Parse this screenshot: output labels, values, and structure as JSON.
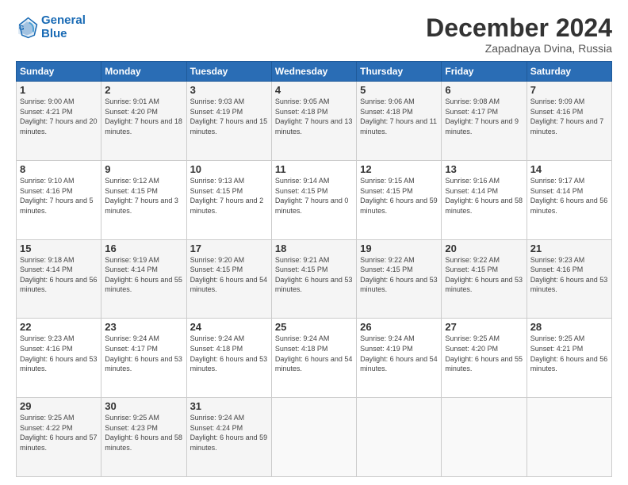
{
  "header": {
    "logo_line1": "General",
    "logo_line2": "Blue",
    "month": "December 2024",
    "location": "Zapadnaya Dvina, Russia"
  },
  "weekdays": [
    "Sunday",
    "Monday",
    "Tuesday",
    "Wednesday",
    "Thursday",
    "Friday",
    "Saturday"
  ],
  "weeks": [
    [
      {
        "day": "1",
        "sunrise": "Sunrise: 9:00 AM",
        "sunset": "Sunset: 4:21 PM",
        "daylight": "Daylight: 7 hours and 20 minutes."
      },
      {
        "day": "2",
        "sunrise": "Sunrise: 9:01 AM",
        "sunset": "Sunset: 4:20 PM",
        "daylight": "Daylight: 7 hours and 18 minutes."
      },
      {
        "day": "3",
        "sunrise": "Sunrise: 9:03 AM",
        "sunset": "Sunset: 4:19 PM",
        "daylight": "Daylight: 7 hours and 15 minutes."
      },
      {
        "day": "4",
        "sunrise": "Sunrise: 9:05 AM",
        "sunset": "Sunset: 4:18 PM",
        "daylight": "Daylight: 7 hours and 13 minutes."
      },
      {
        "day": "5",
        "sunrise": "Sunrise: 9:06 AM",
        "sunset": "Sunset: 4:18 PM",
        "daylight": "Daylight: 7 hours and 11 minutes."
      },
      {
        "day": "6",
        "sunrise": "Sunrise: 9:08 AM",
        "sunset": "Sunset: 4:17 PM",
        "daylight": "Daylight: 7 hours and 9 minutes."
      },
      {
        "day": "7",
        "sunrise": "Sunrise: 9:09 AM",
        "sunset": "Sunset: 4:16 PM",
        "daylight": "Daylight: 7 hours and 7 minutes."
      }
    ],
    [
      {
        "day": "8",
        "sunrise": "Sunrise: 9:10 AM",
        "sunset": "Sunset: 4:16 PM",
        "daylight": "Daylight: 7 hours and 5 minutes."
      },
      {
        "day": "9",
        "sunrise": "Sunrise: 9:12 AM",
        "sunset": "Sunset: 4:15 PM",
        "daylight": "Daylight: 7 hours and 3 minutes."
      },
      {
        "day": "10",
        "sunrise": "Sunrise: 9:13 AM",
        "sunset": "Sunset: 4:15 PM",
        "daylight": "Daylight: 7 hours and 2 minutes."
      },
      {
        "day": "11",
        "sunrise": "Sunrise: 9:14 AM",
        "sunset": "Sunset: 4:15 PM",
        "daylight": "Daylight: 7 hours and 0 minutes."
      },
      {
        "day": "12",
        "sunrise": "Sunrise: 9:15 AM",
        "sunset": "Sunset: 4:15 PM",
        "daylight": "Daylight: 6 hours and 59 minutes."
      },
      {
        "day": "13",
        "sunrise": "Sunrise: 9:16 AM",
        "sunset": "Sunset: 4:14 PM",
        "daylight": "Daylight: 6 hours and 58 minutes."
      },
      {
        "day": "14",
        "sunrise": "Sunrise: 9:17 AM",
        "sunset": "Sunset: 4:14 PM",
        "daylight": "Daylight: 6 hours and 56 minutes."
      }
    ],
    [
      {
        "day": "15",
        "sunrise": "Sunrise: 9:18 AM",
        "sunset": "Sunset: 4:14 PM",
        "daylight": "Daylight: 6 hours and 56 minutes."
      },
      {
        "day": "16",
        "sunrise": "Sunrise: 9:19 AM",
        "sunset": "Sunset: 4:14 PM",
        "daylight": "Daylight: 6 hours and 55 minutes."
      },
      {
        "day": "17",
        "sunrise": "Sunrise: 9:20 AM",
        "sunset": "Sunset: 4:15 PM",
        "daylight": "Daylight: 6 hours and 54 minutes."
      },
      {
        "day": "18",
        "sunrise": "Sunrise: 9:21 AM",
        "sunset": "Sunset: 4:15 PM",
        "daylight": "Daylight: 6 hours and 53 minutes."
      },
      {
        "day": "19",
        "sunrise": "Sunrise: 9:22 AM",
        "sunset": "Sunset: 4:15 PM",
        "daylight": "Daylight: 6 hours and 53 minutes."
      },
      {
        "day": "20",
        "sunrise": "Sunrise: 9:22 AM",
        "sunset": "Sunset: 4:15 PM",
        "daylight": "Daylight: 6 hours and 53 minutes."
      },
      {
        "day": "21",
        "sunrise": "Sunrise: 9:23 AM",
        "sunset": "Sunset: 4:16 PM",
        "daylight": "Daylight: 6 hours and 53 minutes."
      }
    ],
    [
      {
        "day": "22",
        "sunrise": "Sunrise: 9:23 AM",
        "sunset": "Sunset: 4:16 PM",
        "daylight": "Daylight: 6 hours and 53 minutes."
      },
      {
        "day": "23",
        "sunrise": "Sunrise: 9:24 AM",
        "sunset": "Sunset: 4:17 PM",
        "daylight": "Daylight: 6 hours and 53 minutes."
      },
      {
        "day": "24",
        "sunrise": "Sunrise: 9:24 AM",
        "sunset": "Sunset: 4:18 PM",
        "daylight": "Daylight: 6 hours and 53 minutes."
      },
      {
        "day": "25",
        "sunrise": "Sunrise: 9:24 AM",
        "sunset": "Sunset: 4:18 PM",
        "daylight": "Daylight: 6 hours and 54 minutes."
      },
      {
        "day": "26",
        "sunrise": "Sunrise: 9:24 AM",
        "sunset": "Sunset: 4:19 PM",
        "daylight": "Daylight: 6 hours and 54 minutes."
      },
      {
        "day": "27",
        "sunrise": "Sunrise: 9:25 AM",
        "sunset": "Sunset: 4:20 PM",
        "daylight": "Daylight: 6 hours and 55 minutes."
      },
      {
        "day": "28",
        "sunrise": "Sunrise: 9:25 AM",
        "sunset": "Sunset: 4:21 PM",
        "daylight": "Daylight: 6 hours and 56 minutes."
      }
    ],
    [
      {
        "day": "29",
        "sunrise": "Sunrise: 9:25 AM",
        "sunset": "Sunset: 4:22 PM",
        "daylight": "Daylight: 6 hours and 57 minutes."
      },
      {
        "day": "30",
        "sunrise": "Sunrise: 9:25 AM",
        "sunset": "Sunset: 4:23 PM",
        "daylight": "Daylight: 6 hours and 58 minutes."
      },
      {
        "day": "31",
        "sunrise": "Sunrise: 9:24 AM",
        "sunset": "Sunset: 4:24 PM",
        "daylight": "Daylight: 6 hours and 59 minutes."
      },
      null,
      null,
      null,
      null
    ]
  ]
}
